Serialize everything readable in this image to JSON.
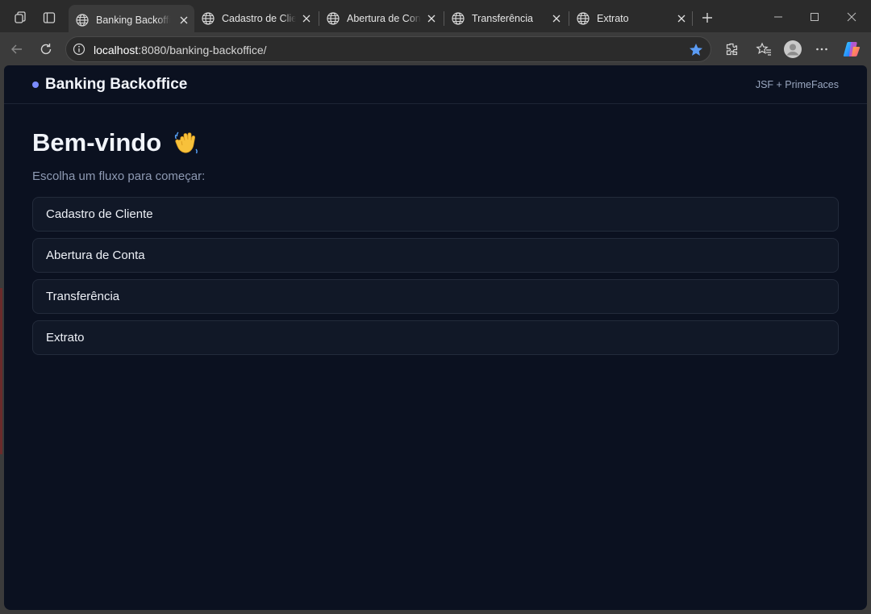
{
  "browser": {
    "tabs": [
      {
        "title": "Banking Backoffice",
        "active": true
      },
      {
        "title": "Cadastro de Cliente",
        "active": false
      },
      {
        "title": "Abertura de Conta",
        "active": false
      },
      {
        "title": "Transferência",
        "active": false
      },
      {
        "title": "Extrato",
        "active": false
      }
    ],
    "address": {
      "host": "localhost",
      "rest": ":8080/banking-backoffice/"
    },
    "icons": [
      "workspaces-icon",
      "tab-actions-icon",
      "back-icon",
      "refresh-icon",
      "site-info-icon",
      "favorite-star-icon",
      "extensions-icon",
      "favorites-icon",
      "profile-avatar",
      "more-menu-icon",
      "copilot-icon"
    ]
  },
  "app": {
    "brand": "Banking Backoffice",
    "tech": "JSF + PrimeFaces",
    "welcome": "Bem-vindo",
    "welcome_emoji": "waving-hand-icon",
    "subtitle": "Escolha um fluxo para começar:",
    "flows": [
      {
        "label": "Cadastro de Cliente"
      },
      {
        "label": "Abertura de Conta"
      },
      {
        "label": "Transferência"
      },
      {
        "label": "Extrato"
      }
    ]
  },
  "colors": {
    "page_bg": "#0b1120",
    "card_bg": "#111827",
    "card_border": "#232b3b",
    "accent_dot": "#7b8cff",
    "muted_text": "#8e9ab3",
    "chrome_bg": "#2b2b2b",
    "chrome_toolbar": "#3b3b3b",
    "star_blue": "#5b9cf5"
  }
}
